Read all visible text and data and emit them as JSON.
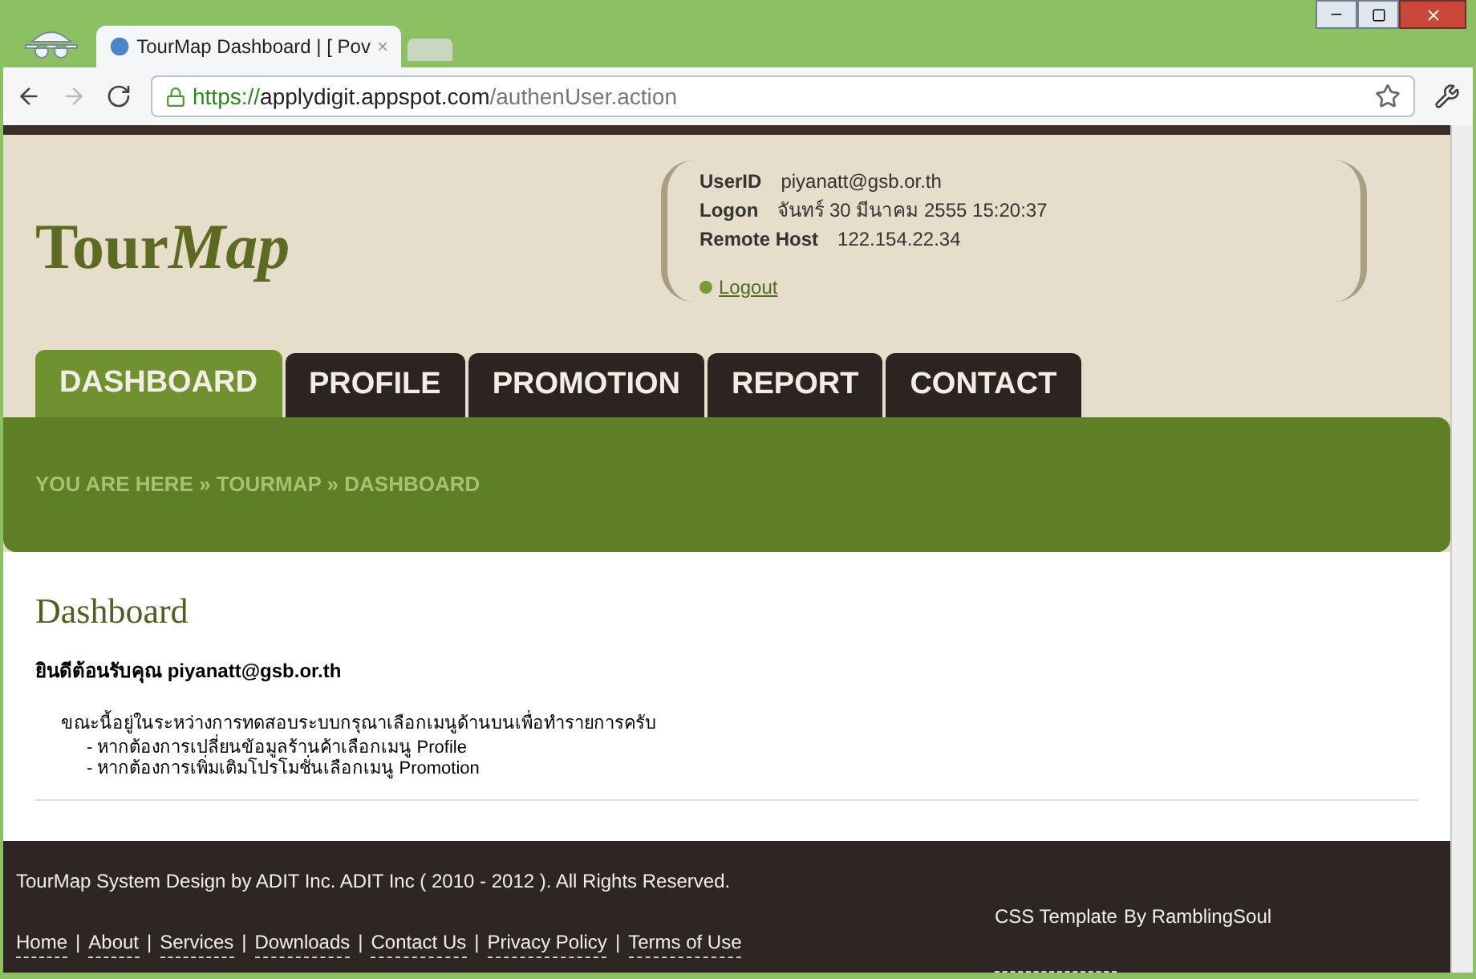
{
  "browser": {
    "tab_title": "TourMap Dashboard | [ Pov",
    "tab_close": "×",
    "url_scheme": "https://",
    "url_host": "applydigit.appspot.com",
    "url_path": "/authenUser.action"
  },
  "header": {
    "logo": {
      "upright": "Tour",
      "italic": "Map"
    },
    "user_fields": [
      {
        "label": "UserID",
        "value": "piyanatt@gsb.or.th"
      },
      {
        "label": "Logon",
        "value": "จันทร์ 30 มีนาคม 2555 15:20:37"
      },
      {
        "label": "Remote Host",
        "value": "122.154.22.34"
      }
    ],
    "logout": "Logout"
  },
  "nav": [
    {
      "label": "DASHBOARD",
      "selected": true
    },
    {
      "label": "PROFILE",
      "selected": false
    },
    {
      "label": "PROMOTION",
      "selected": false
    },
    {
      "label": "REPORT",
      "selected": false
    },
    {
      "label": "CONTACT",
      "selected": false
    }
  ],
  "breadcrumb": "YOU ARE HERE » TOURMAP » DASHBOARD",
  "content": {
    "title": "Dashboard",
    "welcome": "ยินดีต้อนรับคุณ piyanatt@gsb.or.th",
    "intro": "ขณะนี้อยู่ในระหว่างการทดสอบระบบกรุณาเลือกเมนูด้านบนเพื่อทำรายการครับ",
    "items": [
      "- หากต้องการเปลี่ยนข้อมูลร้านค้าเลือกเมนู Profile",
      "- หากต้องการเพิ่มเติมโปรโมชั่นเลือกเมนู Promotion"
    ]
  },
  "footer": {
    "copyright": "TourMap System Design by ADIT Inc. ADIT Inc ( 2010 - 2012 ). All Rights Reserved.",
    "links": [
      "Home",
      "About",
      "Services",
      "Downloads",
      "Contact Us",
      "Privacy Policy",
      "Terms of Use"
    ],
    "separators": [
      "|",
      "|",
      "|",
      "|",
      "|",
      "|"
    ],
    "credit_link": "CSS Template",
    "credit_text": "By RamblingSoul"
  }
}
